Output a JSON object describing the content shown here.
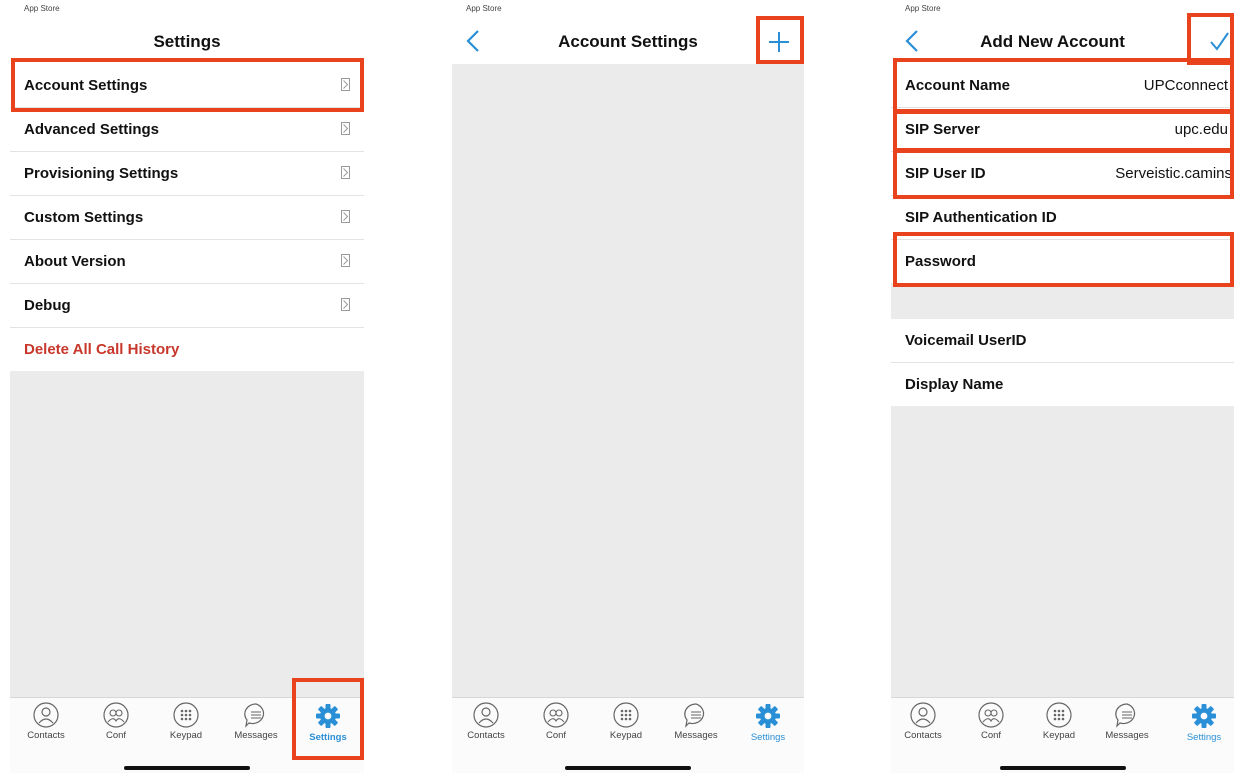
{
  "status_text": "App Store",
  "colors": {
    "highlight": "#e8431d",
    "accent": "#2a8fd6",
    "danger": "#c7372b"
  },
  "tabs": [
    {
      "label": "Contacts",
      "icon": "person-icon"
    },
    {
      "label": "Conf",
      "icon": "group-icon"
    },
    {
      "label": "Keypad",
      "icon": "keypad-icon"
    },
    {
      "label": "Messages",
      "icon": "message-icon"
    },
    {
      "label": "Settings",
      "icon": "gear-icon"
    }
  ],
  "screen1": {
    "title": "Settings",
    "items": [
      {
        "label": "Account Settings"
      },
      {
        "label": "Advanced Settings"
      },
      {
        "label": "Provisioning Settings"
      },
      {
        "label": "Custom Settings"
      },
      {
        "label": "About Version"
      },
      {
        "label": "Debug"
      }
    ],
    "delete_label": "Delete All Call History"
  },
  "screen2": {
    "title": "Account Settings",
    "add_icon": "plus-icon"
  },
  "screen3": {
    "title": "Add New Account",
    "confirm_icon": "checkmark-icon",
    "fields": [
      {
        "label": "Account Name",
        "value": "UPCconnect"
      },
      {
        "label": "SIP Server",
        "value": "upc.edu"
      },
      {
        "label": "SIP User ID",
        "value": "Serveistic.camins"
      },
      {
        "label": "SIP Authentication ID",
        "value": ""
      },
      {
        "label": "Password",
        "value": ""
      }
    ],
    "fields2": [
      {
        "label": "Voicemail UserID",
        "value": ""
      },
      {
        "label": "Display Name",
        "value": ""
      }
    ]
  }
}
